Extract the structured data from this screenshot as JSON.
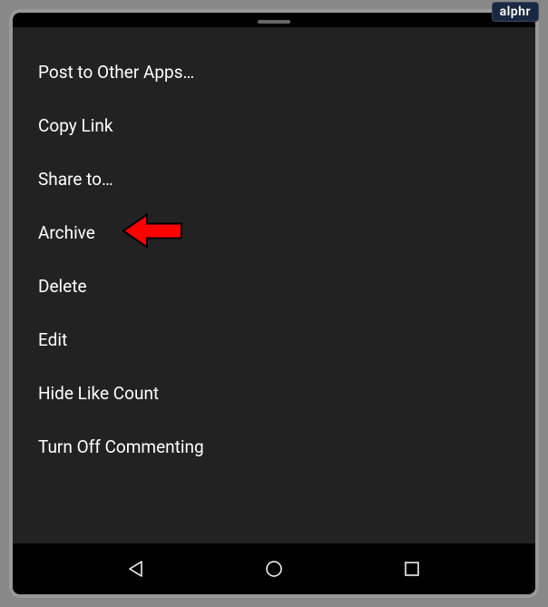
{
  "watermark": "alphr",
  "menu": {
    "items": [
      {
        "label": "Post to Other Apps…",
        "highlighted": false
      },
      {
        "label": "Copy Link",
        "highlighted": false
      },
      {
        "label": "Share to…",
        "highlighted": false
      },
      {
        "label": "Archive",
        "highlighted": true
      },
      {
        "label": "Delete",
        "highlighted": false
      },
      {
        "label": "Edit",
        "highlighted": false
      },
      {
        "label": "Hide Like Count",
        "highlighted": false
      },
      {
        "label": "Turn Off Commenting",
        "highlighted": false
      }
    ]
  },
  "annotation": {
    "arrow_color": "#ff0000"
  }
}
